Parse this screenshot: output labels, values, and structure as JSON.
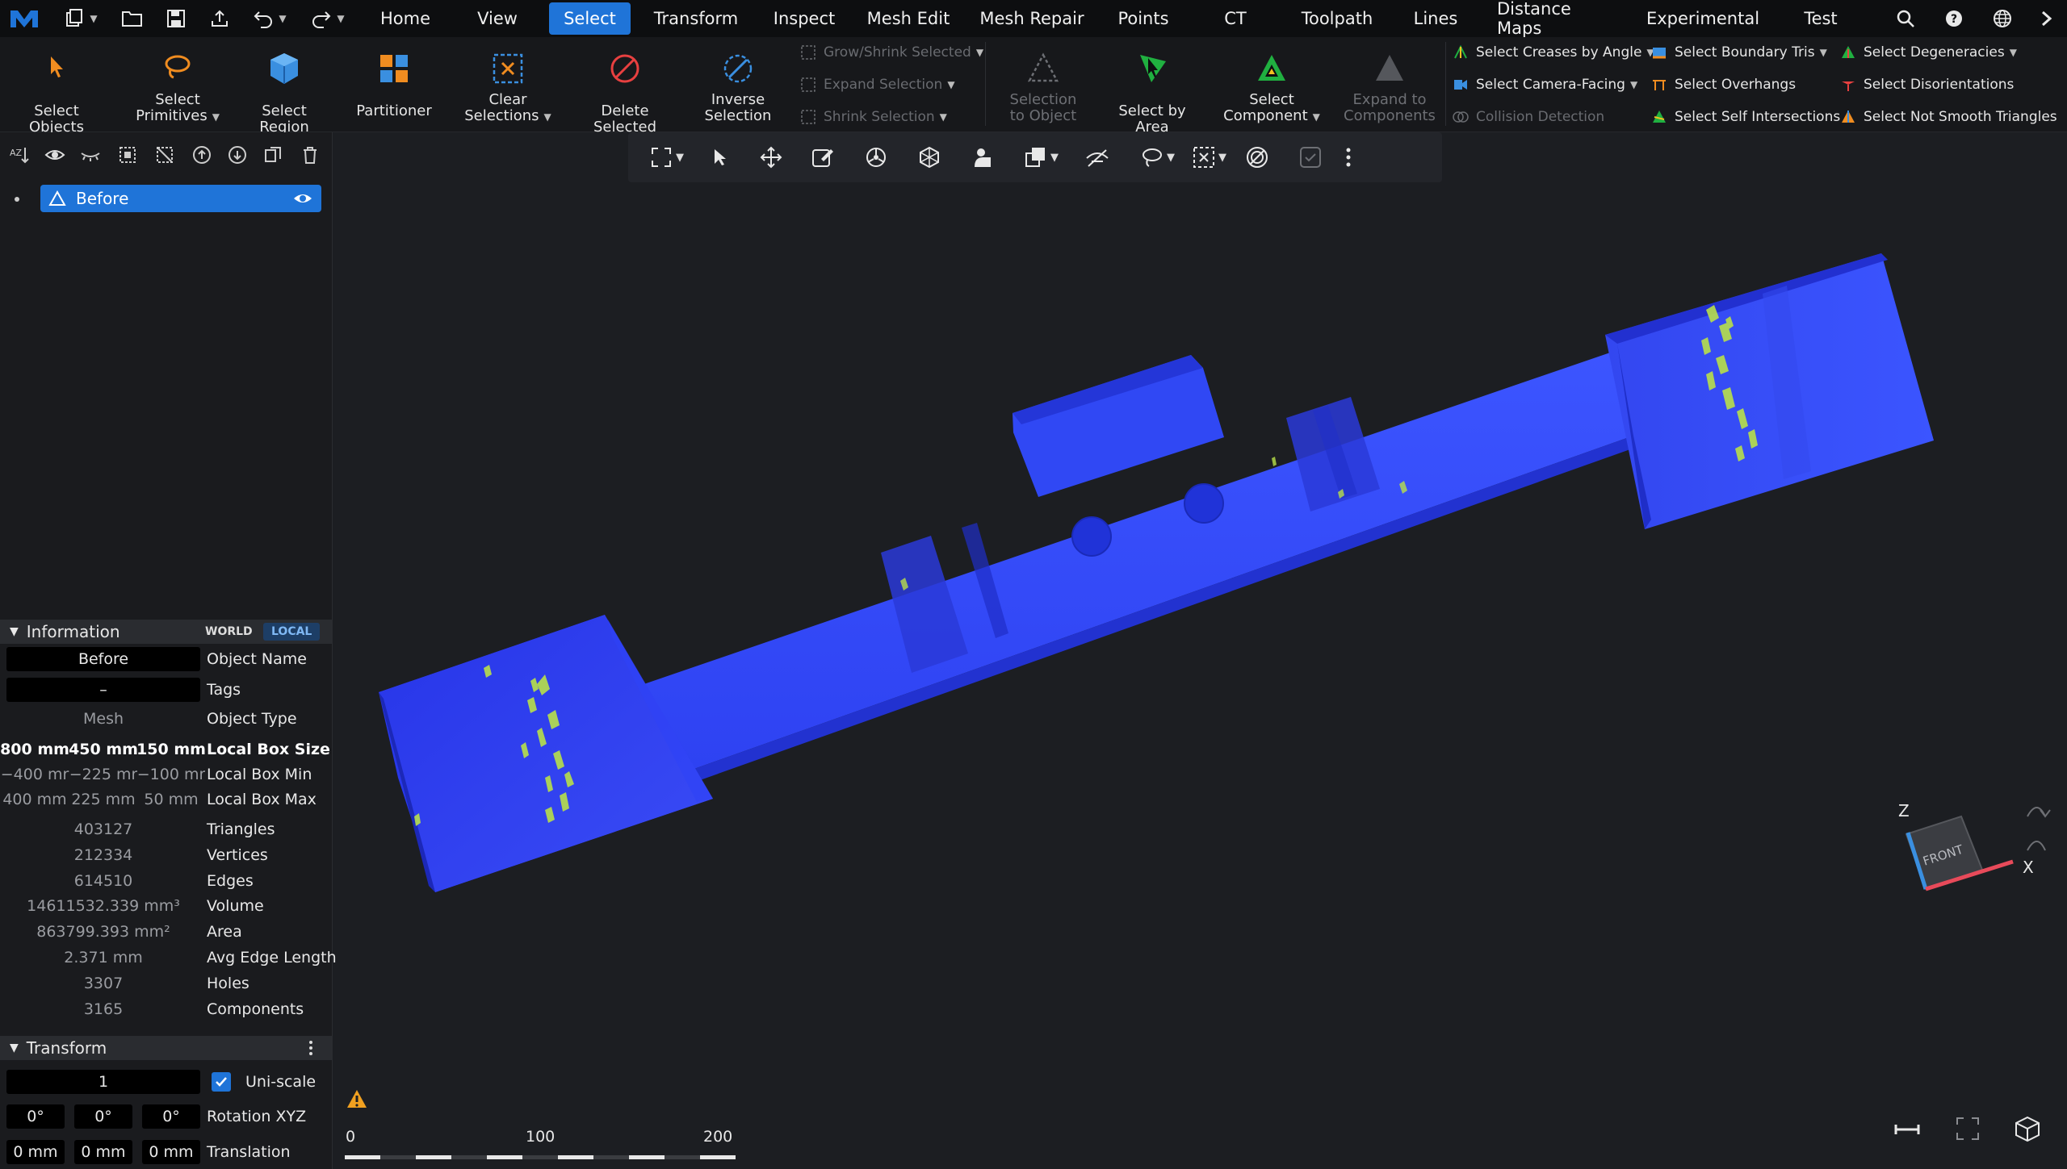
{
  "menubar": {
    "tabs": [
      {
        "label": "Home"
      },
      {
        "label": "View"
      },
      {
        "label": "Select"
      },
      {
        "label": "Transform"
      },
      {
        "label": "Inspect"
      },
      {
        "label": "Mesh Edit"
      },
      {
        "label": "Mesh Repair"
      },
      {
        "label": "Points"
      },
      {
        "label": "CT"
      },
      {
        "label": "Toolpath"
      },
      {
        "label": "Lines"
      },
      {
        "label": "Distance Maps"
      },
      {
        "label": "Experimental"
      },
      {
        "label": "Test"
      }
    ],
    "active_tab": "Select"
  },
  "ribbon": {
    "select_objects": "Select Objects",
    "select_primitives_1": "Select",
    "select_primitives_2": "Primitives",
    "select_region": "Select Region",
    "partitioner": "Partitioner",
    "clear_selections_1": "Clear",
    "clear_selections_2": "Selections",
    "delete_selected": "Delete Selected",
    "inverse_selection_1": "Inverse",
    "inverse_selection_2": "Selection",
    "grow_shrink": "Grow/Shrink Selected",
    "expand_selection": "Expand Selection",
    "shrink_selection": "Shrink Selection",
    "selection_to_object_1": "Selection",
    "selection_to_object_2": "to Object",
    "select_by_area": "Select by Area",
    "select_component_1": "Select",
    "select_component_2": "Component",
    "expand_to_components_1": "Expand to",
    "expand_to_components_2": "Components",
    "select_creases": "Select Creases by Angle",
    "select_camera_facing": "Select Camera-Facing",
    "collision_detection": "Collision Detection",
    "select_boundary_tris": "Select Boundary Tris",
    "select_overhangs": "Select Overhangs",
    "select_self_intersections": "Select Self Intersections",
    "select_degeneracies": "Select Degeneracies",
    "select_disorientations": "Select Disorientations",
    "select_not_smooth": "Select Not Smooth Triangles"
  },
  "tree": {
    "item_label": "Before"
  },
  "information": {
    "header": "Information",
    "world": "WORLD",
    "local": "LOCAL",
    "object_name_value": "Before",
    "object_name_key": "Object Name",
    "tags_value": "–",
    "tags_key": "Tags",
    "object_type_value": "Mesh",
    "object_type_key": "Object Type",
    "box_size": [
      "800 mm",
      "450 mm",
      "150 mm"
    ],
    "box_size_key": "Local Box Size",
    "box_min": [
      "−400 mr",
      "−225 mr",
      "−100 mr"
    ],
    "box_min_key": "Local Box Min",
    "box_max": [
      "400 mm",
      "225 mm",
      "50 mm"
    ],
    "box_max_key": "Local Box Max",
    "triangles_value": "403127",
    "triangles_key": "Triangles",
    "vertices_value": "212334",
    "vertices_key": "Vertices",
    "edges_value": "614510",
    "edges_key": "Edges",
    "volume_value": "14611532.339 mm³",
    "volume_key": "Volume",
    "area_value": "863799.393 mm²",
    "area_key": "Area",
    "avg_edge_value": "2.371 mm",
    "avg_edge_key": "Avg Edge Length",
    "holes_value": "3307",
    "holes_key": "Holes",
    "components_value": "3165",
    "components_key": "Components"
  },
  "transform": {
    "header": "Transform",
    "scale_value": "1",
    "uniscale_label": "Uni-scale",
    "uniscale_checked": true,
    "rotation": [
      "0°",
      "0°",
      "0°"
    ],
    "rotation_key": "Rotation XYZ",
    "translation": [
      "0 mm",
      "0 mm",
      "0 mm"
    ],
    "translation_key": "Translation"
  },
  "viewcube": {
    "face_label": "FRONT",
    "axis_z": "Z",
    "axis_x": "X"
  },
  "ruler": {
    "labels": [
      "0",
      "100",
      "200"
    ]
  },
  "colors": {
    "accent": "#1f74d8",
    "mesh_blue": "#2d3cf0",
    "mesh_highlight": "#b8e04a",
    "warning": "#f0a020"
  }
}
